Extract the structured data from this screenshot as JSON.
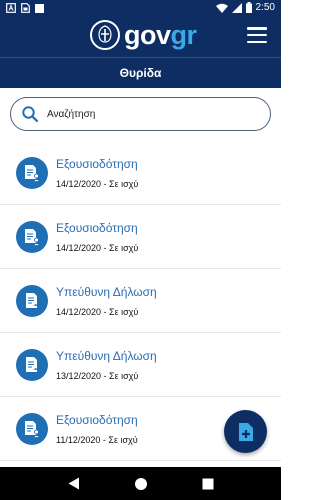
{
  "status_bar": {
    "time": "2:50",
    "left_icons": [
      "notification-a-icon",
      "sim-icon",
      "square-icon"
    ],
    "right_icons": [
      "wifi-icon",
      "cell-signal-icon",
      "battery-icon"
    ]
  },
  "app_bar": {
    "logo_gov": "gov",
    "logo_gr": "gr",
    "menu_icon": "hamburger-menu-icon"
  },
  "page": {
    "title": "Θυρίδα"
  },
  "search": {
    "placeholder": "Αναζήτηση",
    "value": ""
  },
  "documents": [
    {
      "title": "Εξουσιοδότηση",
      "subtitle": "14/12/2020 - Σε ισχύ",
      "icon": "authorization-doc-icon"
    },
    {
      "title": "Εξουσιοδότηση",
      "subtitle": "14/12/2020 - Σε ισχύ",
      "icon": "authorization-doc-icon"
    },
    {
      "title": "Υπεύθυνη Δήλωση",
      "subtitle": "14/12/2020 - Σε ισχύ",
      "icon": "declaration-doc-icon"
    },
    {
      "title": "Υπεύθυνη Δήλωση",
      "subtitle": "13/12/2020 - Σε ισχύ",
      "icon": "declaration-doc-icon"
    },
    {
      "title": "Εξουσιοδότηση",
      "subtitle": "11/12/2020 - Σε ισχύ",
      "icon": "authorization-doc-icon"
    }
  ],
  "fab": {
    "icon": "new-document-icon"
  },
  "nav_bar": {
    "buttons": [
      "back-icon",
      "home-icon",
      "recents-icon"
    ]
  },
  "colors": {
    "primary": "#0d2d63",
    "accent": "#3aa9e6",
    "item_icon_bg": "#1f6fb5",
    "link_text": "#2a6db3"
  }
}
